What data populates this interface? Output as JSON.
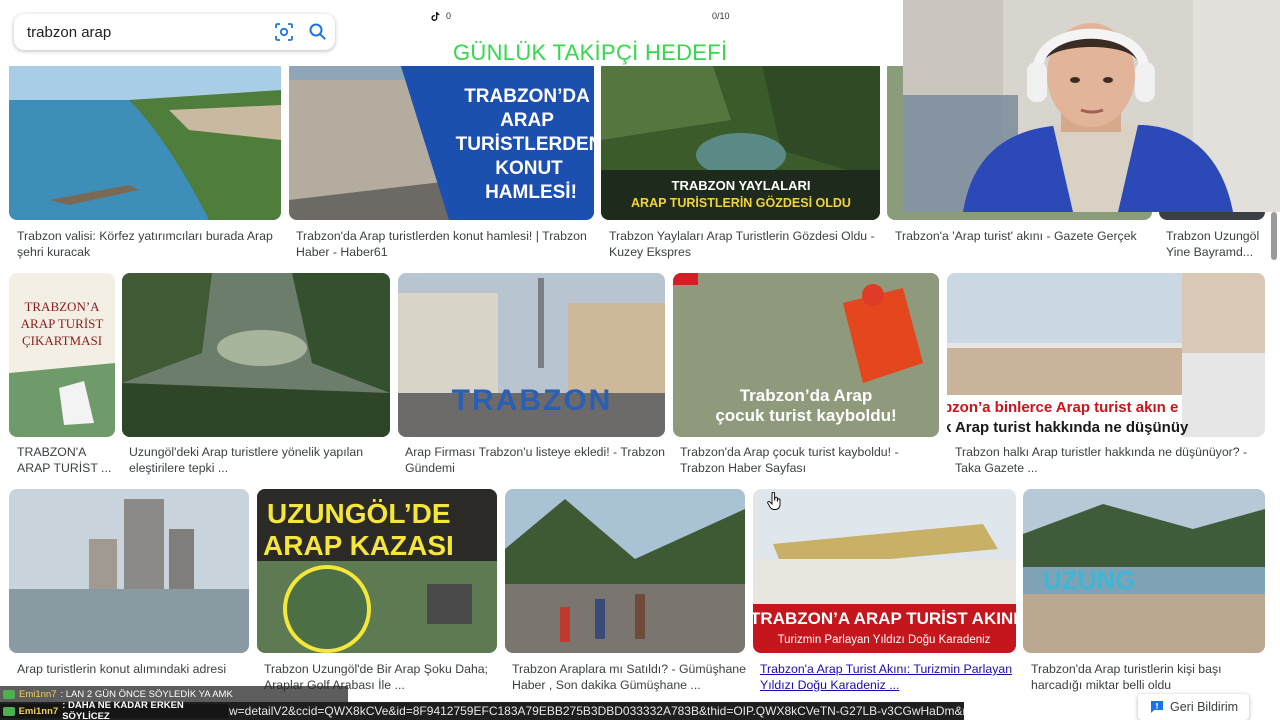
{
  "search": {
    "query": "trabzon arap"
  },
  "overlay": {
    "left_counter": "0",
    "right_counter": "0/10",
    "goal_text": "GÜNLÜK TAKİPÇİ HEDEFİ"
  },
  "results": [
    {
      "thumb_text": "",
      "caption": "Trabzon valisi: Körfez yatırımcıları burada Arap\nşehri kuracak"
    },
    {
      "thumb_text": "TRABZON'DA\nARAP\nTURİSTLERDEN\nKONUT\nHAMLESİ!",
      "caption": "Trabzon'da Arap turistlerden konut hamlesi! | Trabzon\nHaber - Haber61"
    },
    {
      "thumb_text": "TRABZON YAYLALARI\nARAP TURİSTLERİN GÖZDESİ OLDU",
      "caption": "Trabzon Yaylaları Arap Turistlerin Gözdesi Oldu -\nKuzey Ekspres"
    },
    {
      "thumb_text": "",
      "caption": "Trabzon'a 'Arap turist' akını - Gazete Gerçek"
    },
    {
      "thumb_text": "",
      "caption": "Trabzon Uzungöl\nYine Bayramd..."
    },
    {
      "thumb_text": "TRABZON'A\nARAP TURİST\nÇIKARTMASI",
      "caption": "TRABZON'A\nARAP TURİST ..."
    },
    {
      "thumb_text": "",
      "caption": "Uzungöl'deki Arap turistlere yönelik yapılan\neleştirilere tepki ..."
    },
    {
      "thumb_text": "TRABZON",
      "caption": "Arap Firması Trabzon'u listeye ekledi! - Trabzon\nGündemi"
    },
    {
      "thumb_text": "Trabzon'da Arap\nçocuk turist kayboldu!",
      "caption": "Trabzon'da Arap çocuk turist kayboldu! -\nTrabzon Haber Sayfası"
    },
    {
      "thumb_text": "bzon'a binlerce Arap turist akın e\nk Arap turist hakkında ne düşünüy",
      "caption": "Trabzon halkı Arap turistler hakkında ne düşünüyor? -\nTaka Gazete ..."
    },
    {
      "thumb_text": "",
      "caption": "Arap turistlerin konut alımındaki adresi"
    },
    {
      "thumb_text": "UZUNGÖL'DE\nARAP KAZASI",
      "caption": "Trabzon Uzungöl'de Bir Arap Şoku Daha;\nAraplar Golf Arabası İle ..."
    },
    {
      "thumb_text": "",
      "caption": "Trabzon Araplara mı Satıldı? - Gümüşhane\nHaber , Son dakika Gümüşhane ..."
    },
    {
      "thumb_text": "TRABZON'A ARAP TURİST AKINI\nTurizmin Parlayan Yıldızı Doğu Karadeniz",
      "caption": "Trabzon'a Arap Turist Akını: Turizmin Parlayan\nYıldızı Doğu Karadeniz ..."
    },
    {
      "thumb_text": "UZUNG",
      "caption": "Trabzon'da Arap turistlerin kişi başı\nharcadığı miktar belli oldu"
    }
  ],
  "status_url": "w=detailV2&ccid=QWX8kCVe&id=8F9412759EFC183A79EBB275B3DBD033332A783B&thid=OIP.QWX8kCVeTN-G27LB-v3CGwHaDm&mediaur...",
  "chat": {
    "line1_user": "Emi1nn7",
    "line1_text": ": LAN 2 GÜN ÖNCE SÖYLEDİK YA AMK",
    "line2_user": "Emi1nn7",
    "line2_text": ": DAHA NE KADAR ERKEN SÖYLİCEZ"
  },
  "feedback_label": "Geri Bildirim",
  "colors": {
    "goal": "#35d84a",
    "link": "#1a0dab",
    "feedback_icon": "#1a73e8"
  }
}
